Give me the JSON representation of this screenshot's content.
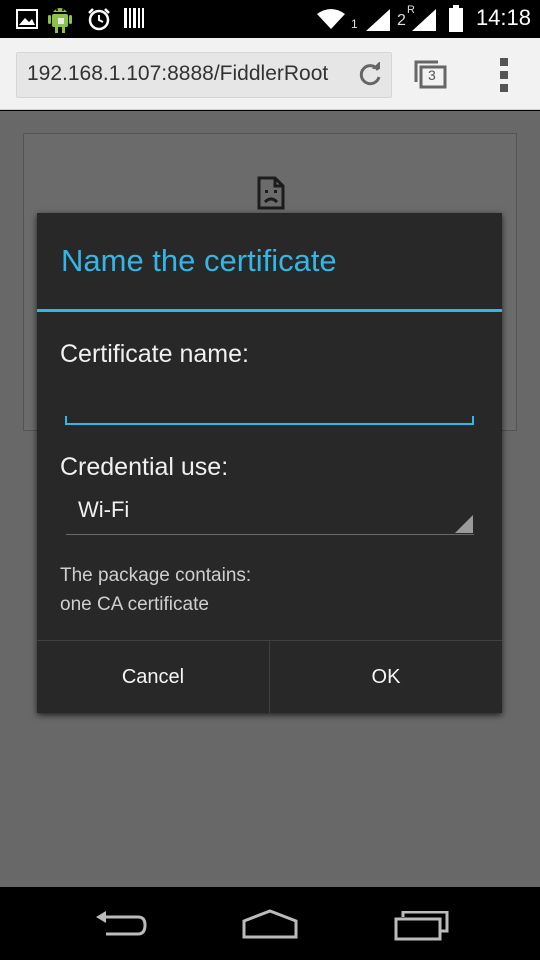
{
  "status_bar": {
    "time": "14:18",
    "sim1_label": "1",
    "sim2_label": "2",
    "sim2_roaming": "R",
    "icons": [
      "gallery-icon",
      "android-debug-icon",
      "alarm-icon",
      "barcode-icon",
      "wifi-icon",
      "signal-icon",
      "signal-icon",
      "battery-icon"
    ]
  },
  "browser": {
    "url": "192.168.1.107:8888/FiddlerRoot",
    "tab_count": "3"
  },
  "dialog": {
    "title": "Name the certificate",
    "certificate_name_label": "Certificate name:",
    "certificate_name_value": "",
    "credential_use_label": "Credential use:",
    "credential_use_value": "Wi-Fi",
    "info_line1": "The package contains:",
    "info_line2": "one CA certificate",
    "cancel_label": "Cancel",
    "ok_label": "OK"
  },
  "colors": {
    "accent": "#33b5e5",
    "dialog_background": "#282828"
  }
}
